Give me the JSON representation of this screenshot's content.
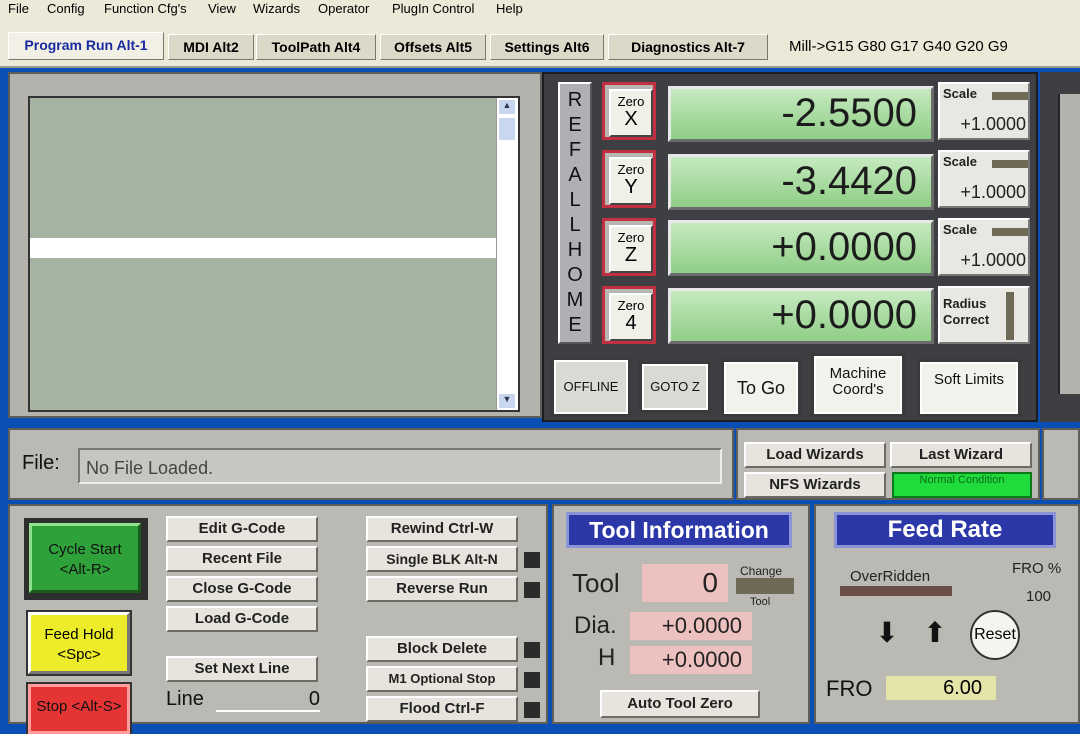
{
  "menu": [
    "File",
    "Config",
    "Function Cfg's",
    "View",
    "Wizards",
    "Operator",
    "PlugIn Control",
    "Help"
  ],
  "tabs": [
    {
      "label": "Program Run Alt-1",
      "active": true
    },
    {
      "label": "MDI Alt2",
      "active": false
    },
    {
      "label": "ToolPath Alt4",
      "active": false
    },
    {
      "label": "Offsets Alt5",
      "active": false
    },
    {
      "label": "Settings Alt6",
      "active": false
    },
    {
      "label": "Diagnostics Alt-7",
      "active": false
    }
  ],
  "modal_line": "Mill->G15  G80 G17 G40 G20 G9",
  "ref_all_home": [
    "R",
    "E",
    "F",
    "A",
    "L",
    "L",
    "H",
    "O",
    "M",
    "E"
  ],
  "axes": [
    {
      "zero_label": "Zero",
      "axis": "X",
      "value": "-2.5500",
      "scale_label": "Scale",
      "scale_value": "+1.0000"
    },
    {
      "zero_label": "Zero",
      "axis": "Y",
      "value": "-3.4420",
      "scale_label": "Scale",
      "scale_value": "+1.0000"
    },
    {
      "zero_label": "Zero",
      "axis": "Z",
      "value": "+0.0000",
      "scale_label": "Scale",
      "scale_value": "+1.0000"
    },
    {
      "zero_label": "Zero",
      "axis": "4",
      "value": "+0.0000",
      "scale_label": "Radius Correct",
      "scale_value": ""
    }
  ],
  "dro_buttons": {
    "offline": "OFFLINE",
    "goto_z": "GOTO Z",
    "to_go": "To Go",
    "machine_coords": "Machine Coord's",
    "soft_limits": "Soft Limits"
  },
  "file": {
    "label": "File:",
    "value": "No File Loaded."
  },
  "wizards": {
    "load": "Load Wizards",
    "last": "Last Wizard",
    "nfs": "NFS Wizards",
    "status": "Normal Condition"
  },
  "controls": {
    "cycle_start": "Cycle Start <Alt-R>",
    "feed_hold": "Feed Hold <Spc>",
    "stop": "Stop <Alt-S>",
    "edit_gcode": "Edit G-Code",
    "recent_file": "Recent File",
    "close_gcode": "Close G-Code",
    "load_gcode": "Load G-Code",
    "set_next_line": "Set Next Line",
    "line_label": "Line",
    "line_value": "0",
    "rewind": "Rewind Ctrl-W",
    "single_blk": "Single BLK Alt-N",
    "reverse_run": "Reverse Run",
    "block_delete": "Block Delete",
    "m1_optional": "M1 Optional Stop",
    "flood": "Flood Ctrl-F"
  },
  "tool_info": {
    "title": "Tool Information",
    "tool_label": "Tool",
    "tool_value": "0",
    "change_label": "Change",
    "tool_small": "Tool",
    "dia_label": "Dia.",
    "dia_value": "+0.0000",
    "h_label": "H",
    "h_value": "+0.0000",
    "auto_tool_zero": "Auto Tool Zero"
  },
  "feed_rate": {
    "title": "Feed Rate",
    "overridden": "OverRidden",
    "fro_pct_label": "FRO %",
    "fro_pct_value": "100",
    "reset": "Reset",
    "fro_label": "FRO",
    "fro_value": "6.00"
  },
  "colors": {
    "accent_blue": "#2d38a8",
    "dro_green": "#9fd896",
    "status_green": "#1fdc3c"
  }
}
